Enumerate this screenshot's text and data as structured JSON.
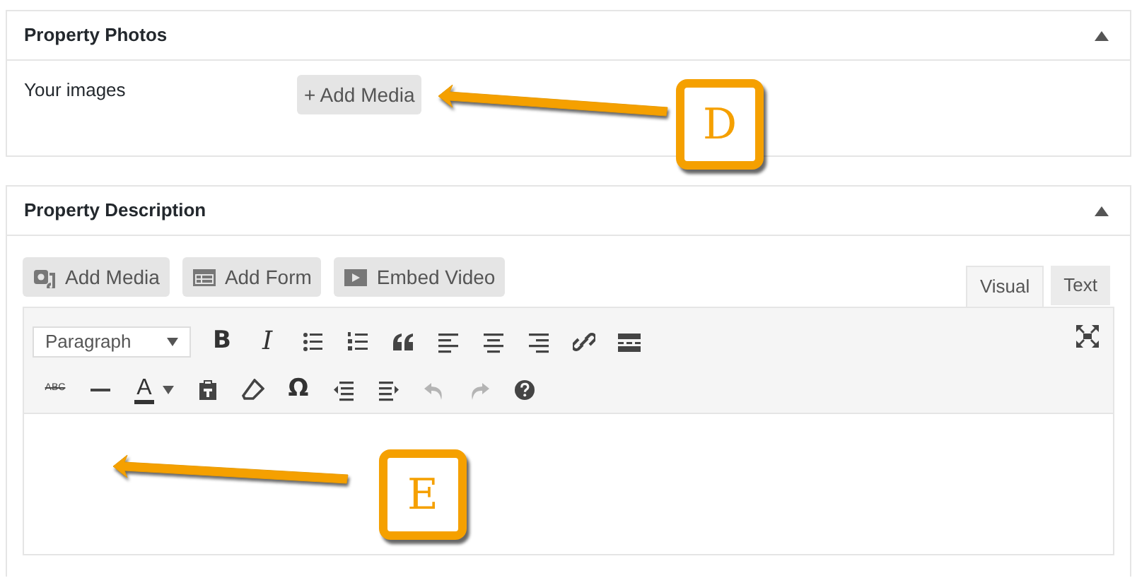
{
  "panels": [
    {
      "title": "Property Photos",
      "expanded": true,
      "field_label": "Your images",
      "button": "+ Add Media"
    },
    {
      "title": "Property Description",
      "expanded": true
    }
  ],
  "editor": {
    "media_buttons": [
      {
        "kind": "media",
        "label": "Add Media"
      },
      {
        "kind": "form",
        "label": "Add Form"
      },
      {
        "kind": "video",
        "label": "Embed Video"
      }
    ],
    "tabs": [
      {
        "label": "Visual",
        "selected": true
      },
      {
        "label": "Text",
        "selected": false
      }
    ],
    "format_select": "Paragraph",
    "toolbar_rows": [
      [
        {
          "kind": "bold",
          "label": "B"
        },
        {
          "kind": "italic",
          "label": "I"
        },
        {
          "kind": "bullets"
        },
        {
          "kind": "numbers"
        },
        {
          "kind": "quote"
        },
        {
          "kind": "align-left"
        },
        {
          "kind": "align-center"
        },
        {
          "kind": "align-right"
        },
        {
          "kind": "link"
        },
        {
          "kind": "more"
        }
      ],
      [
        {
          "kind": "strike",
          "label": "ABC"
        },
        {
          "kind": "hr"
        },
        {
          "kind": "color",
          "label": "A"
        },
        {
          "kind": "paste"
        },
        {
          "kind": "eraser"
        },
        {
          "kind": "glyph",
          "label": "Ω"
        },
        {
          "kind": "outdent"
        },
        {
          "kind": "indent"
        },
        {
          "kind": "undo",
          "disabled": true
        },
        {
          "kind": "redo",
          "disabled": true
        },
        {
          "kind": "help"
        }
      ]
    ]
  },
  "annotations": [
    {
      "label": "D"
    },
    {
      "label": "E"
    }
  ]
}
